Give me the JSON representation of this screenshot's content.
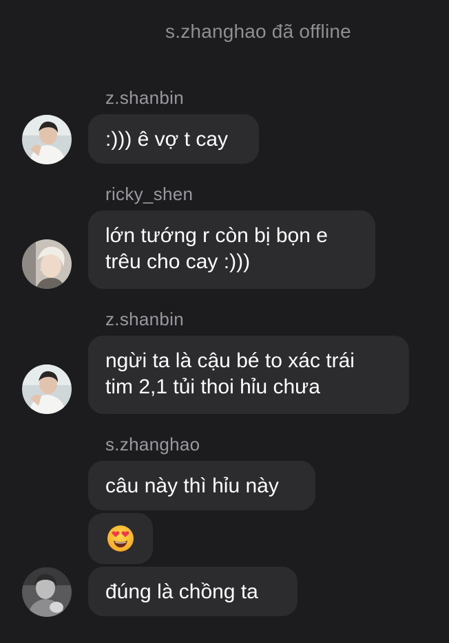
{
  "status": "s.zhanghao đã offline",
  "messages": [
    {
      "sender": "z.shanbin",
      "lines": [
        ":))) ê vợ t cay"
      ]
    },
    {
      "sender": "ricky_shen",
      "lines": [
        "lớn tướng r còn bị bọn e",
        "trêu cho cay :)))"
      ]
    },
    {
      "sender": "z.shanbin",
      "lines": [
        "ngừi ta là cậu bé to xác trái",
        "tim 2,1 tủi thoi hỉu chưa"
      ]
    },
    {
      "sender": "s.zhanghao",
      "lines": [
        "câu này thì hỉu này"
      ]
    },
    {
      "emoji": "smiling-face-with-heart-eyes"
    },
    {
      "lines": [
        "đúng là chồng ta"
      ]
    }
  ],
  "avatars": {
    "z_shanbin": "avatar-z-shanbin",
    "ricky_shen": "avatar-ricky-shen",
    "s_zhanghao": "avatar-s-zhanghao"
  },
  "colors": {
    "background": "#1c1c1e",
    "bubble": "#2c2c2e",
    "muted_text": "#8e8e93",
    "text": "#ffffff"
  }
}
